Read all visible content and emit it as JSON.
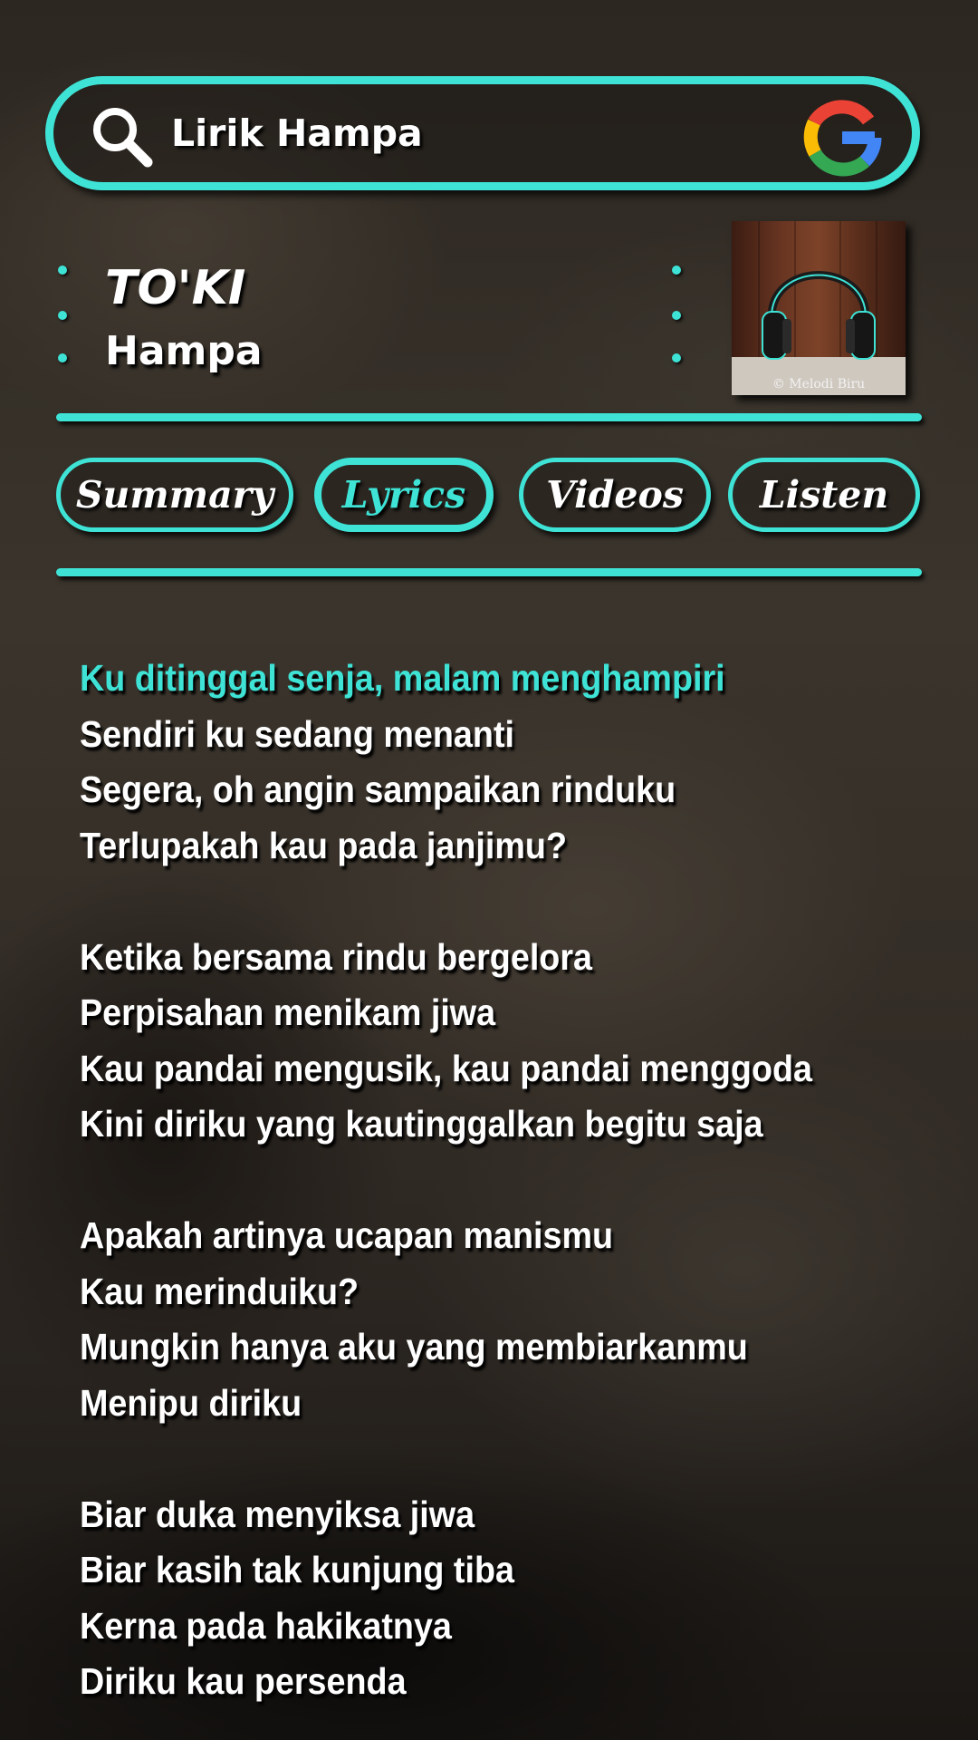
{
  "search": {
    "query": "Lirik Hampa",
    "search_icon": "search-icon",
    "provider_icon": "google-icon"
  },
  "song": {
    "artist": "TO'KI",
    "title": "Hampa",
    "album_art": {
      "icon": "headphones-icon",
      "caption": "© Melodi Biru"
    }
  },
  "tabs": [
    {
      "label": "Summary",
      "active": false
    },
    {
      "label": "Lyrics",
      "active": true
    },
    {
      "label": "Videos",
      "active": false
    },
    {
      "label": "Listen",
      "active": false
    }
  ],
  "lyrics": {
    "current_line": "Ku ditinggal senja, malam menghampiri",
    "stanzas": [
      [
        "Ku ditinggal senja, malam menghampiri",
        "Sendiri ku sedang menanti",
        "Segera, oh angin sampaikan rinduku",
        "Terlupakah kau pada janjimu?"
      ],
      [
        "Ketika bersama rindu bergelora",
        "Perpisahan menikam jiwa",
        "Kau pandai mengusik, kau pandai menggoda",
        "Kini diriku yang kautinggalkan begitu saja"
      ],
      [
        "Apakah artinya ucapan manismu",
        "Kau merinduiku?",
        "Mungkin hanya aku yang membiarkanmu",
        "Menipu diriku"
      ],
      [
        "Biar duka menyiksa jiwa",
        "Biar kasih tak kunjung tiba",
        "Kerna pada hakikatnya",
        "Diriku kau persenda"
      ]
    ]
  },
  "colors": {
    "accent": "#3ee3d6",
    "text": "#ffffff"
  }
}
